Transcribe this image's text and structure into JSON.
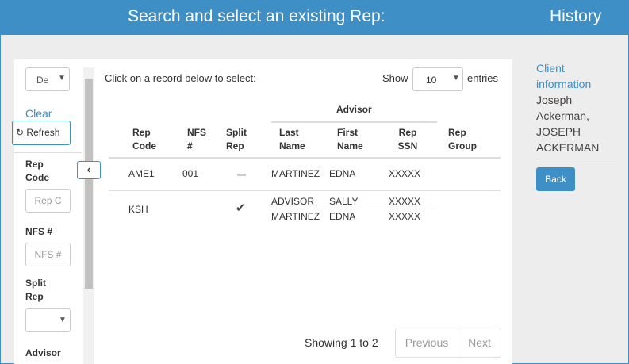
{
  "header": {
    "title": "Search and select an existing Rep:",
    "history": "History"
  },
  "filters": {
    "top_select": "De",
    "clear": "Clear",
    "refresh": "Refresh",
    "rep_code_label": "Rep Code",
    "rep_code_placeholder": "Rep C",
    "nfs_label": "NFS #",
    "nfs_placeholder": "NFS #",
    "split_label": "Split Rep",
    "split_value": "",
    "advisor_label": "Advisor"
  },
  "main": {
    "instruction": "Click on a record below to select:",
    "show": "Show",
    "entries_value": "10",
    "entries": "entries",
    "group_header": "Advisor",
    "columns": [
      "Rep Code",
      "NFS #",
      "Split Rep",
      "Last Name",
      "First Name",
      "Rep SSN",
      "Rep Group"
    ],
    "rows": [
      {
        "rep_code": "AME1",
        "nfs": "001",
        "split": "no",
        "advisors": [
          {
            "last": "MARTINEZ",
            "first": "EDNA",
            "ssn": "XXXXX"
          }
        ],
        "group": ""
      },
      {
        "rep_code": "KSH",
        "nfs": "",
        "split": "yes",
        "advisors": [
          {
            "last": "ADVISOR",
            "first": "SALLY",
            "ssn": "XXXXX"
          },
          {
            "last": "MARTINEZ",
            "first": "EDNA",
            "ssn": "XXXXX"
          }
        ],
        "group": ""
      }
    ],
    "showing": "Showing 1 to 2",
    "previous": "Previous",
    "next": "Next"
  },
  "sidebar": {
    "client_info": "Client information",
    "client_name": "Joseph Ackerman, JOSEPH ACKERMAN",
    "back": "Back"
  },
  "colors": {
    "accent": "#3d8fc6"
  }
}
